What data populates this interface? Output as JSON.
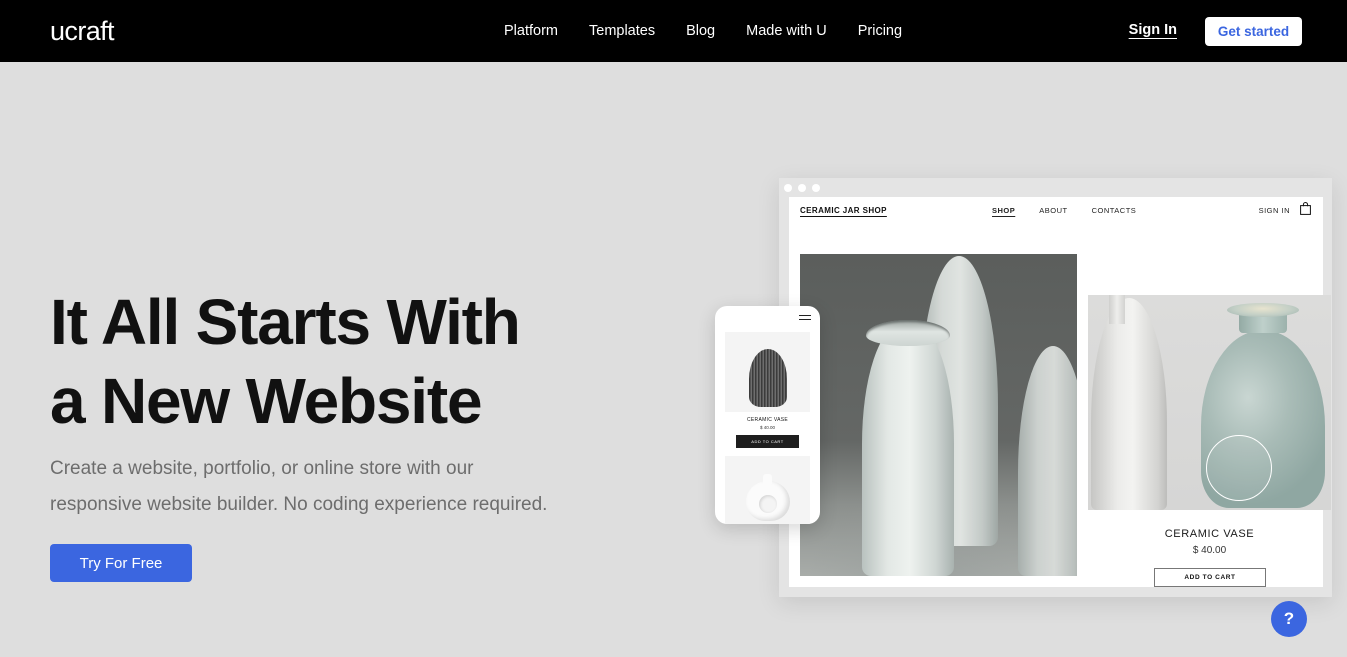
{
  "colors": {
    "brand_blue": "#3b66e0",
    "topbar_bg": "#000000",
    "page_bg": "#dedede",
    "heading": "#111111",
    "subtext": "#6d6d6d"
  },
  "header": {
    "logo": "ucraft",
    "nav": [
      {
        "label": "Platform"
      },
      {
        "label": "Templates"
      },
      {
        "label": "Blog"
      },
      {
        "label": "Made with U"
      },
      {
        "label": "Pricing"
      }
    ],
    "sign_in": "Sign In",
    "get_started": "Get started"
  },
  "hero": {
    "title_line1": "It All Starts With",
    "title_line2": "a New Website",
    "subtitle_line1": "Create a website, portfolio, or online store with our",
    "subtitle_line2": "responsive website builder. No coding experience required.",
    "cta": "Try For Free"
  },
  "mockup": {
    "browser": {
      "window_dots": 3,
      "site_nav": {
        "brand": "CERAMIC JAR SHOP",
        "links": [
          {
            "label": "SHOP",
            "active": true
          },
          {
            "label": "ABOUT",
            "active": false
          },
          {
            "label": "CONTACTS",
            "active": false
          }
        ],
        "sign_in": "SIGN IN",
        "cart_icon": "shopping-bag-icon"
      },
      "product": {
        "name": "CERAMIC VASE",
        "price": "$ 40.00",
        "add_to_cart": "ADD TO CART"
      }
    },
    "phone": {
      "menu_icon": "hamburger-icon",
      "product": {
        "name": "CERAMIC VASE",
        "price": "$ 40.00",
        "add_to_cart": "ADD TO CART"
      }
    }
  },
  "help": {
    "label": "?"
  }
}
